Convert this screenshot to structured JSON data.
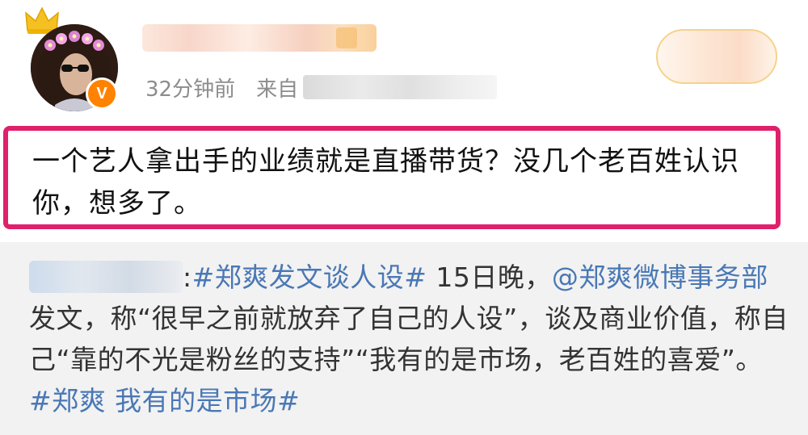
{
  "header": {
    "time": "32分钟前",
    "source_label": "来自",
    "verified_badge": "V"
  },
  "comment": {
    "text": "一个艺人拿出手的业绩就是直播带货？没几个老百姓认识你，想多了。"
  },
  "repost": {
    "author_suffix": ":",
    "hashtag_topic": "#郑爽发文谈人设#",
    "text_after_topic": " 15日晚，",
    "mention": "@郑爽微博事务部",
    "body": " 发文，称“很早之前就放弃了自己的人设”，谈及商业价值，称自己“靠的不光是粉丝的支持”“我有的是市场，老百姓的喜爱”。",
    "hashtag_end": "#郑爽 我有的是市场#"
  },
  "colors": {
    "highlight_border": "#e0206a",
    "link": "#4a78b5",
    "verified": "#ff8200",
    "meta_text": "#8c8c8c"
  }
}
